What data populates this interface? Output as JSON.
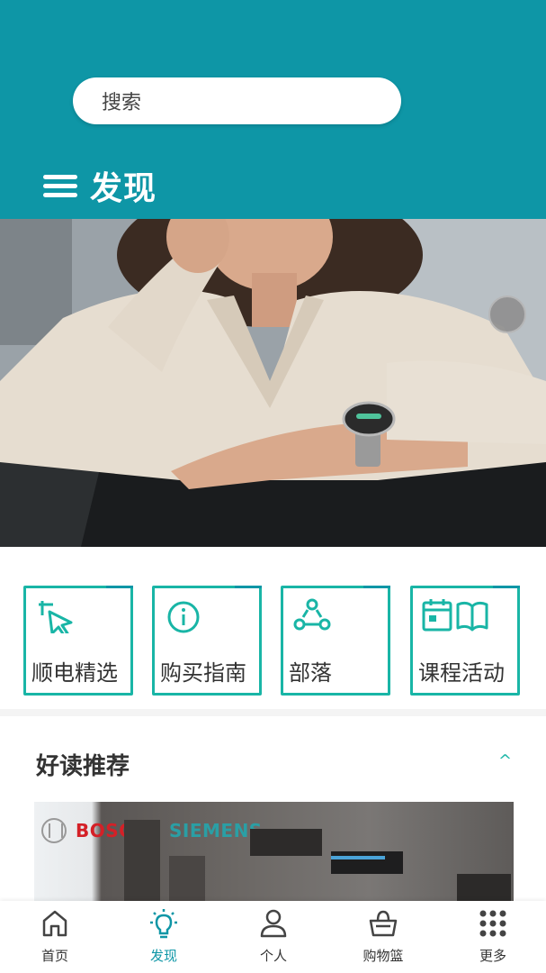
{
  "header": {
    "search_placeholder": "搜索",
    "title": "发现",
    "background_color": "#0e96a6"
  },
  "banner": {
    "slide_count": 6,
    "active_slide": 3
  },
  "shortcuts": [
    {
      "label": "顺电精选",
      "icon": "cursor-click-icon"
    },
    {
      "label": "购买指南",
      "icon": "info-icon"
    },
    {
      "label": "部落",
      "icon": "community-icon"
    },
    {
      "label": "课程活动",
      "icon": "calendar-book-icon"
    }
  ],
  "section": {
    "title": "好读推荐",
    "toggle": "^"
  },
  "article": {
    "brand1": "BOSCH",
    "brand2": "SIEMENS"
  },
  "tabbar": {
    "items": [
      {
        "label": "首页",
        "icon": "home-icon"
      },
      {
        "label": "发现",
        "icon": "lightbulb-icon"
      },
      {
        "label": "个人",
        "icon": "person-icon"
      },
      {
        "label": "购物篮",
        "icon": "basket-icon"
      },
      {
        "label": "更多",
        "icon": "grid-icon"
      }
    ],
    "active": "发现",
    "accent_color": "#0e96a6"
  }
}
